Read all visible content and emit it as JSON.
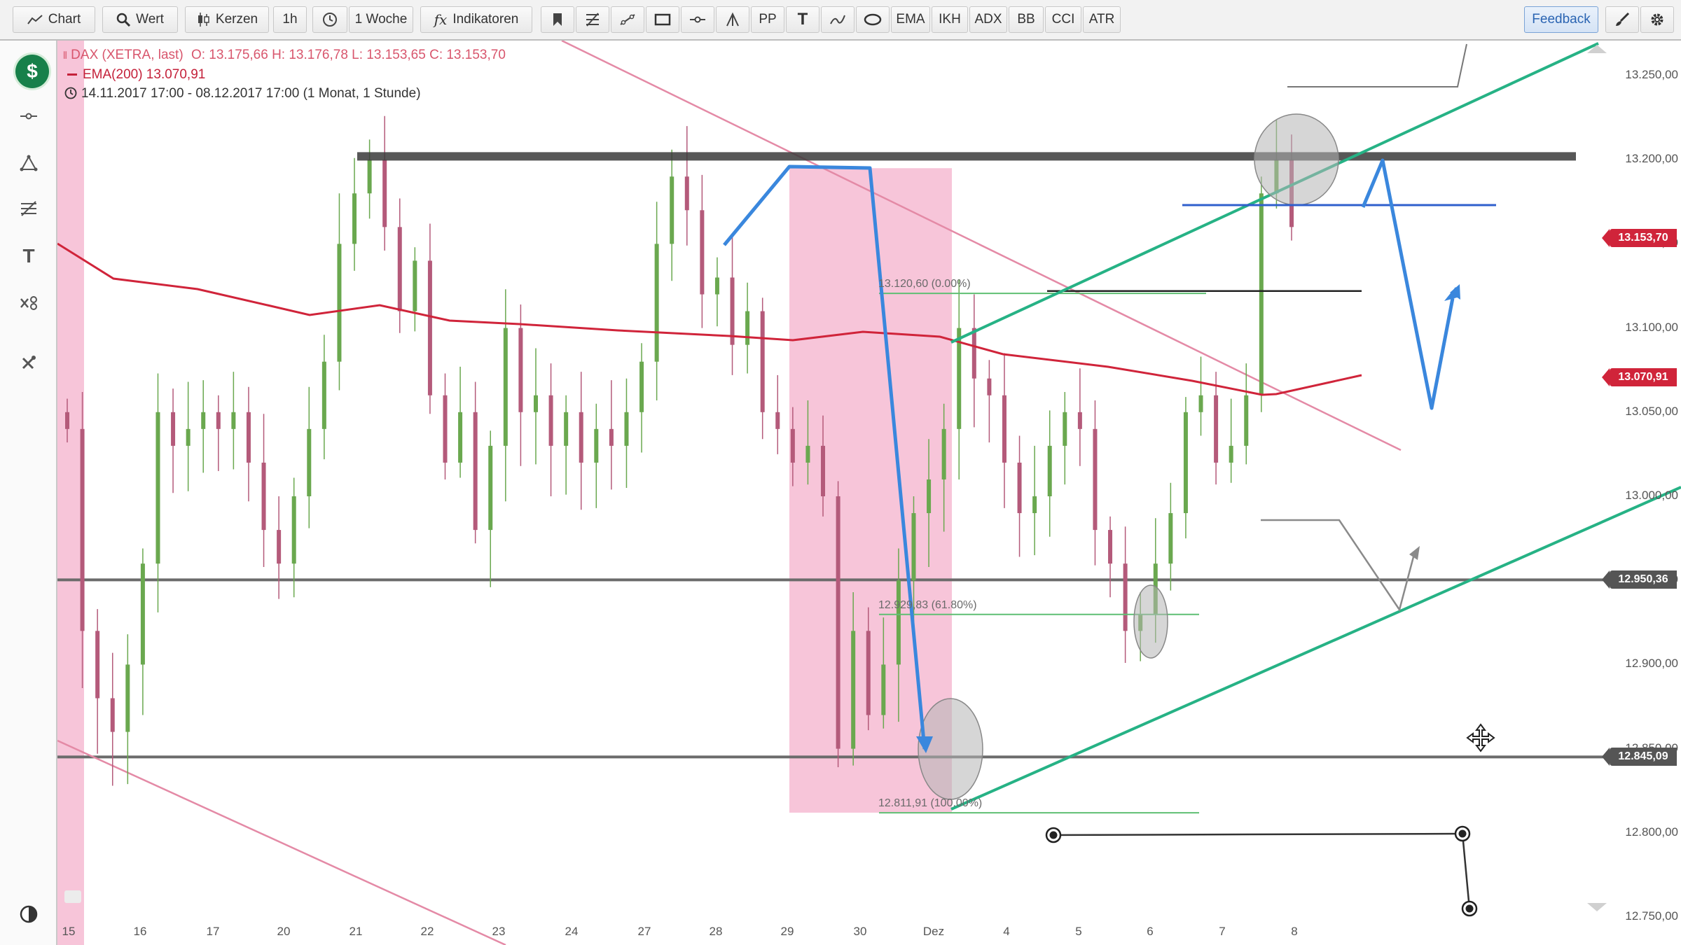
{
  "toolbar": {
    "chart_label": "Chart",
    "wert_label": "Wert",
    "kerzen_label": "Kerzen",
    "interval_label": "1h",
    "period_label": "1 Woche",
    "indicators_label": "Indikatoren",
    "pp_label": "PP",
    "text_label": "T",
    "ema_label": "EMA",
    "ikh_label": "IKH",
    "adx_label": "ADX",
    "bb_label": "BB",
    "cci_label": "CCI",
    "atr_label": "ATR",
    "feedback_label": "Feedback"
  },
  "header": {
    "instrument": "DAX (XETRA, last)",
    "ohlc": "O: 13.175,66  H: 13.176,78  L: 13.153,65  C: 13.153,70",
    "ema": "EMA(200)  13.070,91",
    "range": "14.11.2017 17:00 - 08.12.2017 17:00  (1 Monat, 1 Stunde)"
  },
  "sidebar": {
    "logo_text": "$",
    "text_tool": "T"
  },
  "colors": {
    "ema": "#d0243a",
    "up_candle": "#6aa84f",
    "down_candle": "#b45a7a",
    "highlight": "#f5b6d0",
    "trend_channel": "#26b285",
    "arrow": "#3a87dd",
    "resistance": "#3a3a3a"
  },
  "price_tags": [
    {
      "value": "13.153,70",
      "color": "#d0243a",
      "price": 13153.7
    },
    {
      "value": "13.070,91",
      "color": "#d0243a",
      "price": 13070.91
    },
    {
      "value": "12.950,36",
      "color": "#555555",
      "price": 12950.36
    },
    {
      "value": "12.845,09",
      "color": "#555555",
      "price": 12845.09
    }
  ],
  "fib_labels": [
    {
      "text": "13.120,60 (0.00%)",
      "price": 13120.6
    },
    {
      "text": "12.929,83 (61.80%)",
      "price": 12929.83
    },
    {
      "text": "12.811,91 (100.00%)",
      "price": 12811.91
    }
  ],
  "chart_data": {
    "type": "candlestick",
    "title": "DAX (XETRA, last)",
    "series": [
      {
        "name": "EMA(200)",
        "last": 13070.91
      }
    ],
    "ylim": [
      12745,
      13270
    ],
    "y_ticks": [
      12750,
      12800,
      12850,
      12900,
      12950,
      13000,
      13050,
      13100,
      13150,
      13200,
      13250
    ],
    "y_tick_labels": [
      "12.750,00",
      "12.800,00",
      "12.850,00",
      "12.900,00",
      "12.950,00",
      "13.000,00",
      "13.050,00",
      "13.100,00",
      "13.150,00",
      "13.200,00",
      "13.250,00"
    ],
    "x_tick_labels": [
      "15",
      "16",
      "17",
      "20",
      "21",
      "22",
      "23",
      "24",
      "27",
      "28",
      "29",
      "30",
      "Dez",
      "4",
      "5",
      "6",
      "7",
      "8"
    ],
    "horizontal_lines": [
      13200,
      12950.36,
      12845.09
    ],
    "candles_close": [
      13040,
      12920,
      12880,
      12860,
      12900,
      12960,
      13050,
      13030,
      13040,
      13050,
      13040,
      13050,
      13020,
      12980,
      12960,
      13000,
      13040,
      13080,
      13150,
      13180,
      13200,
      13160,
      13110,
      13140,
      13060,
      13020,
      13050,
      12980,
      13030,
      13100,
      13050,
      13060,
      13030,
      13050,
      13020,
      13040,
      13030,
      13050,
      13080,
      13150,
      13190,
      13170,
      13120,
      13130,
      13090,
      13110,
      13050,
      13040,
      13020,
      13030,
      13000,
      12850,
      12920,
      12870,
      12900,
      12950,
      12990,
      13010,
      13040,
      13100,
      13070,
      13060,
      13020,
      12990,
      13000,
      13030,
      13050,
      13040,
      12980,
      12960,
      12920,
      12930,
      12960,
      12990,
      13050,
      13060,
      13020,
      13030,
      13060,
      13180,
      13200,
      13160
    ],
    "grid": false
  }
}
